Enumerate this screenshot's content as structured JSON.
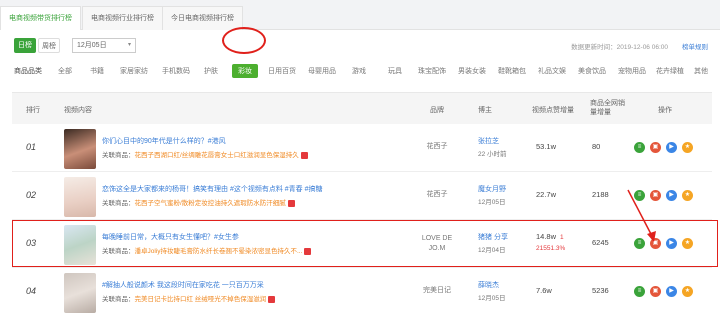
{
  "tabs": [
    {
      "label": "电商视频带货排行榜",
      "active": true
    },
    {
      "label": "电商视频行业排行榜",
      "active": false
    },
    {
      "label": "今日电商视频排行榜",
      "active": false
    }
  ],
  "controls": {
    "day_label": "日榜",
    "week_label": "周榜",
    "date_value": "12月05日",
    "update_time": "数据更新时间：2019-12-06 06:00",
    "help_label": "榜单规则"
  },
  "categories": {
    "label": "商品品类",
    "items": [
      "全部",
      "书籍",
      "家居家纺",
      "手机数码",
      "护肤",
      "彩妆",
      "日用百货",
      "母婴用品",
      "游戏",
      "玩具",
      "珠宝配饰",
      "男装女装",
      "鞋靴箱包",
      "礼品文娱",
      "美食饮品",
      "宠物用品",
      "花卉绿植",
      "其他"
    ],
    "active_index": 5
  },
  "table": {
    "headers": {
      "rank": "排行",
      "content": "视频内容",
      "brand": "品牌",
      "blogger": "博主",
      "views": "视频点赞增量",
      "sales": "商品全网销量增量",
      "ops": "操作"
    },
    "rel_prefix": "关联商品：",
    "rows": [
      {
        "rank": "01",
        "title": "你们心目中的90年代是什么样的？#港风",
        "product": "花西子西湖口红/丝绸雕花唇膏女士口红滋润显色保湿持久",
        "brand": "花西子",
        "blogger": "张拉芝",
        "date": "22 小时前",
        "views": "53.1w",
        "views_extra": "",
        "pct": "",
        "sales": "80"
      },
      {
        "rank": "02",
        "title": "恋饰这全是大家都来的杨哥！搞笑有理由 #这个视频有点料 #青春 #搞糖",
        "product": "花西子空气蜜粉/散粉定妆控油持久遮瑕防水防汗细腻",
        "brand": "花西子",
        "blogger": "魔女月野",
        "date": "12月05日",
        "views": "22.7w",
        "views_extra": "",
        "pct": "",
        "sales": "2188"
      },
      {
        "rank": "03",
        "title": "每晚睡前日常，大概只有女生懂吧？#女生参",
        "product": "潘卓Joliy持妆睫毛膏防水纤长卷翘不晕染浓密显色持久不...",
        "brand": "LOVE DE JO.M",
        "blogger": "猪猪 分享",
        "date": "12月04日",
        "views": "14.8w",
        "views_extra": "1",
        "pct": "21551.3%",
        "sales": "6245"
      },
      {
        "rank": "04",
        "title": "#解抽人般说颜术 我这段时间在家吃花 一只百万万采",
        "product": "完美日记卡比持口红 丝绒哑光不掉色保湿滋润",
        "brand": "完美日记",
        "blogger": "薛晓杰",
        "date": "12月05日",
        "views": "7.6w",
        "views_extra": "",
        "pct": "",
        "sales": "5236"
      }
    ]
  },
  "colors": {
    "accent": "#3aa33a",
    "link": "#3b7ed6",
    "highlight": "#e0201b"
  }
}
